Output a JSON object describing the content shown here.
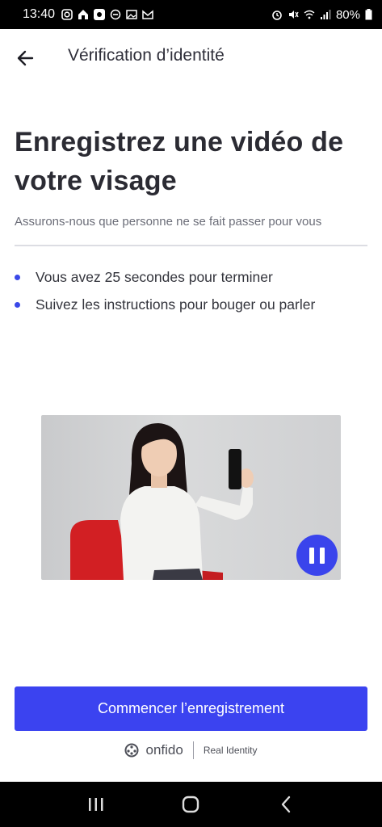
{
  "status_bar": {
    "time": "13:40",
    "battery": "80%"
  },
  "header": {
    "title": "Vérification d’identité",
    "back_icon": "arrow-left-icon"
  },
  "main": {
    "title": "Enregistrez une vidéo de votre visage",
    "subtitle": "Assurons-nous que personne ne se fait passer pour vous",
    "bullets": [
      "Vous avez 25 secondes pour terminer",
      "Suivez les instructions pour bouger ou parler"
    ]
  },
  "video": {
    "pause_icon": "pause-icon"
  },
  "cta": {
    "label": "Commencer l’enregistrement"
  },
  "footer": {
    "brand": "onfido",
    "tagline": "Real Identity"
  },
  "colors": {
    "accent": "#3b43f0",
    "bullet": "#3a48e8"
  }
}
